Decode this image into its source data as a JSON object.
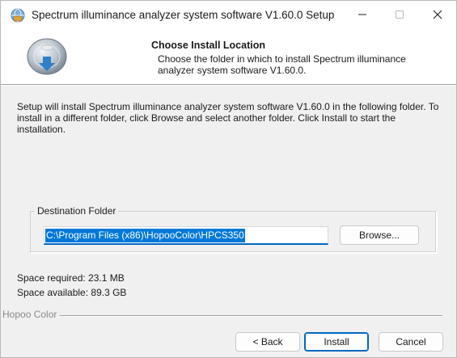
{
  "window": {
    "title": "Spectrum illuminance analyzer system software V1.60.0 Setup",
    "icons": {
      "app": "installer-globe-icon",
      "minimize": "minimize-icon",
      "maximize": "maximize-icon",
      "close": "close-icon"
    }
  },
  "header": {
    "title": "Choose Install Location",
    "subtitle": "Choose the folder in which to install Spectrum illuminance analyzer system software V1.60.0.",
    "icon": "install-disc-icon"
  },
  "body": {
    "description": "Setup will install Spectrum illuminance analyzer system software V1.60.0 in the following folder. To install in a different folder, click Browse and select another folder. Click Install to start the installation.",
    "destination_label": "Destination Folder",
    "destination_path": "C:\\Program Files (x86)\\HopooColor\\HPCS350",
    "browse_label": "Browse...",
    "space_required": "Space required: 23.1 MB",
    "space_available": "Space available: 89.3 GB"
  },
  "footer": {
    "brand": "Hopoo Color",
    "back_label": "< Back",
    "install_label": "Install",
    "cancel_label": "Cancel"
  },
  "colors": {
    "accent": "#0078d7",
    "window_bg": "#f0f0f0",
    "header_bg": "#ffffff"
  }
}
